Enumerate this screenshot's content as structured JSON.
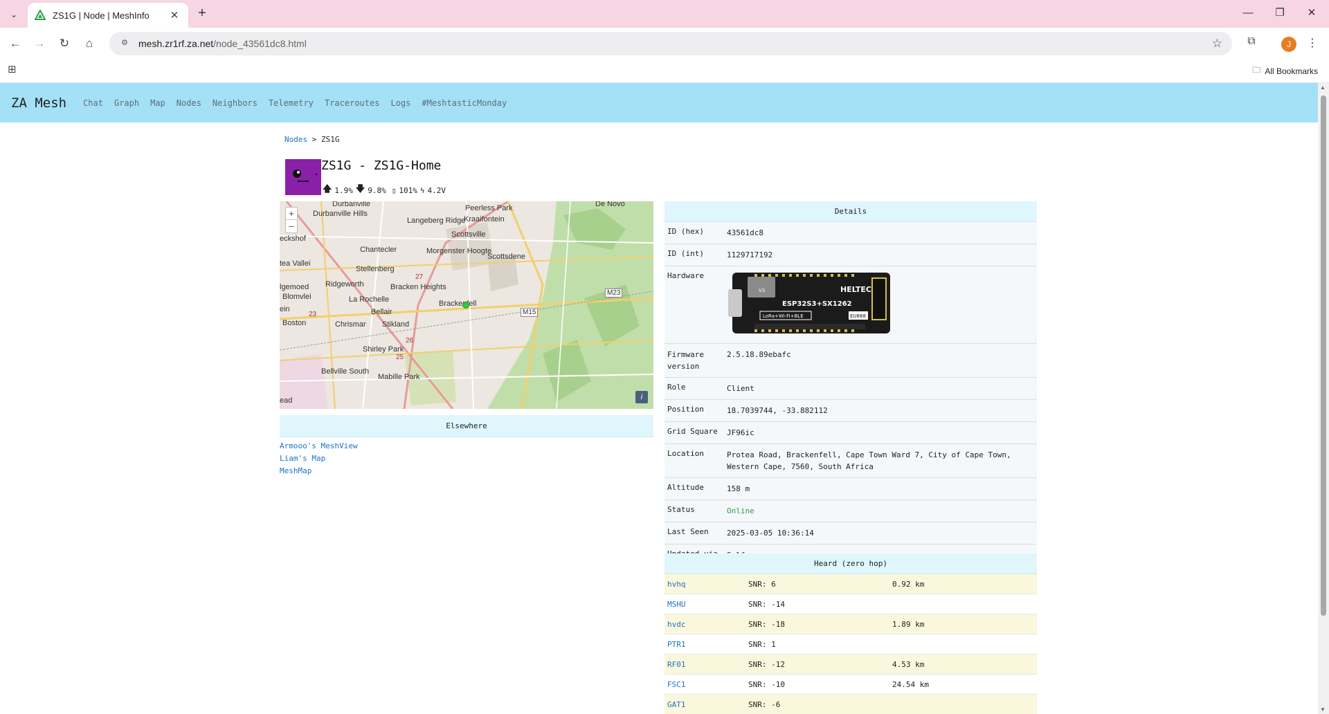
{
  "browser": {
    "tab_title": "ZS1G | Node | MeshInfo",
    "url_host": "mesh.zr1rf.za.net",
    "url_path": "/node_43561dc8.html",
    "profile_initial": "J",
    "all_bookmarks": "All Bookmarks"
  },
  "nav": {
    "brand": "ZA Mesh",
    "links": [
      "Chat",
      "Graph",
      "Map",
      "Nodes",
      "Neighbors",
      "Telemetry",
      "Traceroutes",
      "Logs",
      "#MeshtasticMonday"
    ]
  },
  "breadcrumb": {
    "parent": "Nodes",
    "separator": ">",
    "current": "ZS1G"
  },
  "node": {
    "title": "ZS1G - ZS1G-Home",
    "tx_util": "1.9%",
    "rx_util": "9.8%",
    "battery": "101%",
    "voltage": "4.2V"
  },
  "map": {
    "zoom_in": "+",
    "zoom_out": "–",
    "info": "i",
    "marker_color": "#2ecc40",
    "labels": [
      "Durbanville",
      "Durbanville Hills",
      "Peerless Park",
      "Kraaifontein",
      "De Novo",
      "Langeberg Ridge",
      "Scottsville",
      "eckshof",
      "Chantecler",
      "Morgenster Hoogte",
      "Scottsdene",
      "tea Vallei",
      "Stellenberg",
      "Ridgeworth",
      "Bracken Heights",
      "M23",
      "lgemoed",
      "Blomvlei",
      "La Rochelle",
      "Brackenfell",
      "ein",
      "23",
      "Bellair",
      "M15",
      "Boston",
      "Chrismar",
      "Stikland",
      "26",
      "Shirley Park",
      "25",
      "Bellville South",
      "Mabille Park",
      "ead",
      "27"
    ]
  },
  "elsewhere": {
    "title": "Elsewhere",
    "links": [
      "Armooo's MeshView",
      "Liam's Map",
      "MeshMap"
    ]
  },
  "details": {
    "title": "Details",
    "rows": [
      {
        "label": "ID (hex)",
        "value": "43561dc8"
      },
      {
        "label": "ID (int)",
        "value": "1129717192"
      },
      {
        "label": "Hardware",
        "value": ""
      },
      {
        "label": "Firmware version",
        "value": "2.5.18.89ebafc"
      },
      {
        "label": "Role",
        "value": "Client"
      },
      {
        "label": "Position",
        "value": "18.7039744, -33.882112"
      },
      {
        "label": "Grid Square",
        "value": "JF96ic"
      },
      {
        "label": "Location",
        "value": "Protea Road, Brackenfell, Cape Town Ward 7, City of Cape Town, Western Cape, 7560, South Africa"
      },
      {
        "label": "Altitude",
        "value": "158 m"
      },
      {
        "label": "Status",
        "value": "Online"
      },
      {
        "label": "Last Seen",
        "value": "2025-03-05 10:36:14"
      },
      {
        "label": "Updated via",
        "value": "Self"
      }
    ],
    "hardware_board": {
      "brand": "HELTEC",
      "chip": "ESP32S3+SX1262",
      "version": "V3",
      "features": "LoRa+Wi-Fi+BLE",
      "region": "EU868"
    }
  },
  "heard": {
    "title": "Heard (zero hop)",
    "rows": [
      {
        "name": "hvhq",
        "snr": "SNR: 6",
        "dist": "0.92 km"
      },
      {
        "name": "MSHU",
        "snr": "SNR: -14",
        "dist": ""
      },
      {
        "name": "hvdc",
        "snr": "SNR: -18",
        "dist": "1.89 km"
      },
      {
        "name": "PTR1",
        "snr": "SNR: 1",
        "dist": ""
      },
      {
        "name": "RF01",
        "snr": "SNR: -12",
        "dist": "4.53 km"
      },
      {
        "name": "FSC1",
        "snr": "SNR: -10",
        "dist": "24.54 km"
      },
      {
        "name": "GAT1",
        "snr": "SNR: -6",
        "dist": ""
      }
    ]
  }
}
